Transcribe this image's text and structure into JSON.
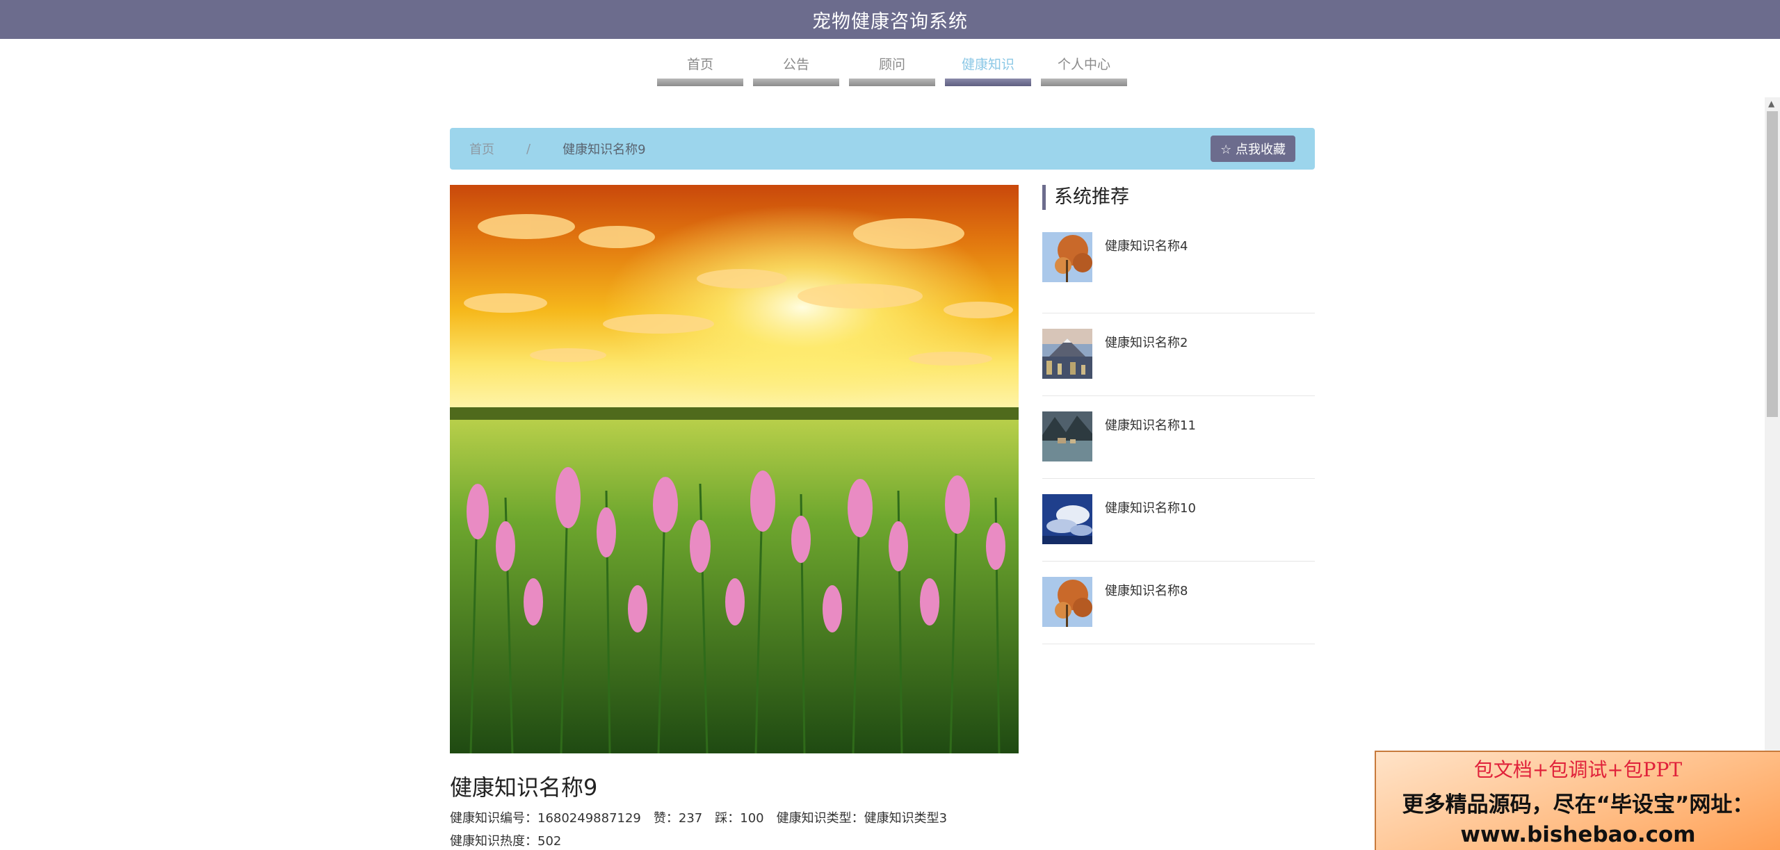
{
  "site_title": "宠物健康咨询系统",
  "nav": [
    {
      "label": "首页",
      "active": false
    },
    {
      "label": "公告",
      "active": false
    },
    {
      "label": "顾问",
      "active": false
    },
    {
      "label": "健康知识",
      "active": true
    },
    {
      "label": "个人中心",
      "active": false
    }
  ],
  "breadcrumb": {
    "home": "首页",
    "separator": "/",
    "current": "健康知识名称9",
    "favorite_icon": "star-outline-icon",
    "favorite_label": "☆ 点我收藏"
  },
  "detail": {
    "title": "健康知识名称9",
    "meta1": {
      "code_label": "健康知识编号：",
      "code_value": "1680249887129",
      "like_label": "赞：",
      "like_value": "237",
      "dislike_label": "踩：",
      "dislike_value": "100",
      "type_label": "健康知识类型：",
      "type_value": "健康知识类型3"
    },
    "meta2": {
      "heat_label": "健康知识热度：",
      "heat_value": "502"
    }
  },
  "sidebar": {
    "heading": "系统推荐",
    "items": [
      {
        "title": "健康知识名称4"
      },
      {
        "title": "健康知识名称2"
      },
      {
        "title": "健康知识名称11"
      },
      {
        "title": "健康知识名称10"
      },
      {
        "title": "健康知识名称8"
      }
    ]
  },
  "ad": {
    "line1": "包文档+包调试+包PPT",
    "line2": "更多精品源码，尽在“毕设宝”网址：",
    "line3": "www.bishebao.com"
  },
  "colors": {
    "primary": "#6c6c8d",
    "breadcrumb_bg": "#9cd5ec",
    "nav_active_text": "#8cc8e6"
  }
}
